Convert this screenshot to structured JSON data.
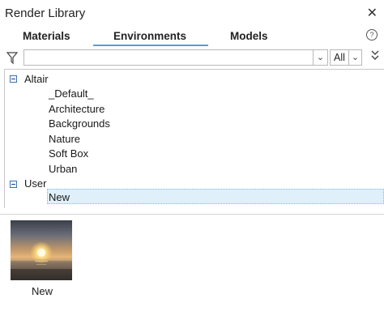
{
  "window": {
    "title": "Render Library",
    "close_glyph": "✕"
  },
  "tabs": {
    "items": [
      {
        "label": "Materials",
        "active": false
      },
      {
        "label": "Environments",
        "active": true
      },
      {
        "label": "Models",
        "active": false
      }
    ],
    "help_glyph": "?"
  },
  "filter": {
    "search_value": "",
    "search_placeholder": "",
    "search_dropdown_glyph": "⌄",
    "scope_value": "All",
    "scope_dropdown_glyph": "⌄",
    "expand_glyph": "≫"
  },
  "tree": {
    "groups": [
      {
        "label": "Altair",
        "expanded": true,
        "children": [
          "_Default_",
          "Architecture",
          "Backgrounds",
          "Nature",
          "Soft Box",
          "Urban"
        ]
      },
      {
        "label": "User",
        "expanded": true,
        "children": [
          "New"
        ]
      }
    ],
    "selected_item": "New"
  },
  "thumbnails": [
    {
      "label": "New",
      "image": "sunset-over-water"
    }
  ],
  "colors": {
    "accent_underline": "#4aa3df",
    "selection_fill": "#dff0fb",
    "selection_border": "#7fbbe4",
    "expander_border": "#3d6fb0"
  }
}
